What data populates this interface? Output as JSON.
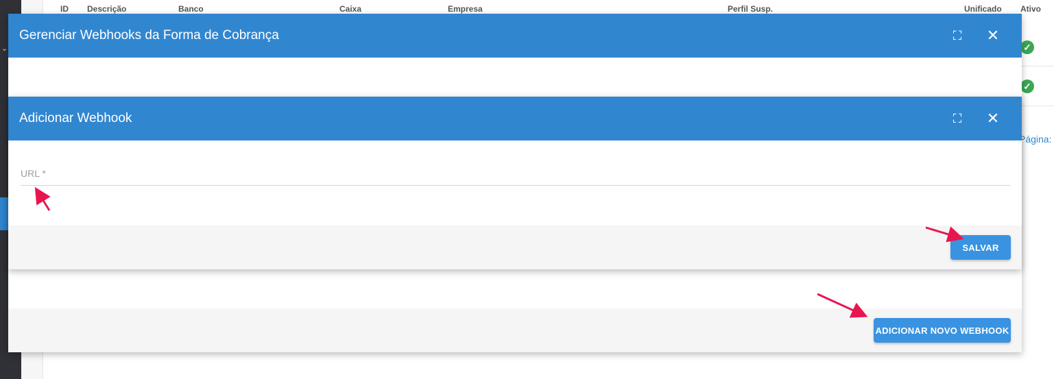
{
  "table": {
    "headers": [
      "ID",
      "Descrição",
      "Banco",
      "Caixa",
      "Empresa",
      "Perfil Susp.",
      "Unificado",
      "Ativo"
    ]
  },
  "pagination": {
    "label": "Página:"
  },
  "dialog_main": {
    "title": "Gerenciar Webhooks da Forma de Cobrança",
    "add_button": "ADICIONAR NOVO WEBHOOK"
  },
  "dialog_add": {
    "title": "Adicionar Webhook",
    "url_label": "URL *",
    "url_value": "",
    "save_button": "SALVAR"
  },
  "colors": {
    "header_blue": "#3186d0",
    "button_blue": "#3a93e0",
    "annotation_arrow": "#e8154f",
    "check_green": "#3ba755"
  }
}
